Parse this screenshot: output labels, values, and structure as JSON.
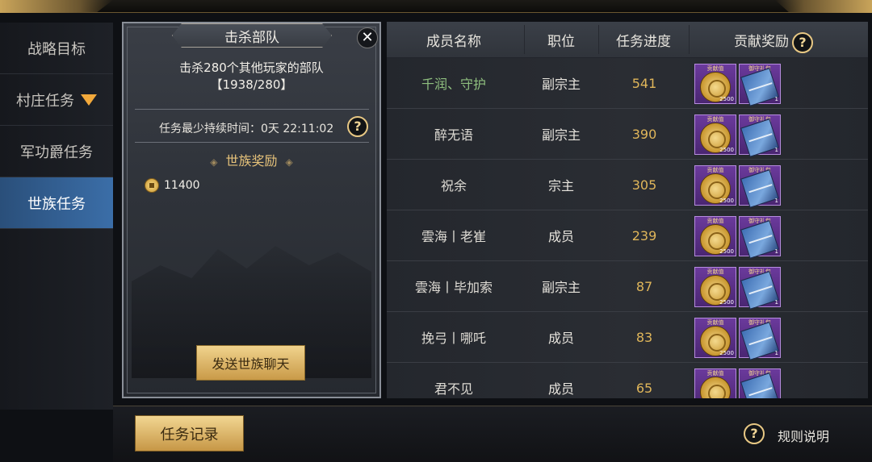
{
  "nav": {
    "items": [
      {
        "label": "战略目标"
      },
      {
        "label": "村庄任务"
      },
      {
        "label": "军功爵任务"
      },
      {
        "label": "世族任务"
      }
    ]
  },
  "task_panel": {
    "title": "击杀部队",
    "description": "击杀280个其他玩家的部队",
    "progress_text": "【1938/280】",
    "duration_text": "任务最少持续时间：0天 22:11:02",
    "reward_title": "世族奖励",
    "reward_amount": "11400",
    "send_chat_label": "发送世族聊天",
    "close_glyph": "✕",
    "help_glyph": "?"
  },
  "members": {
    "headers": {
      "name": "成员名称",
      "role": "职位",
      "progress": "任务进度",
      "reward": "贡献奖励"
    },
    "reward_labels": {
      "medal": "贡献值",
      "pack": "御守礼包"
    },
    "rows": [
      {
        "name": "千润、守护",
        "role": "副宗主",
        "progress": "541",
        "medal_count": "2500",
        "pack_count": "1"
      },
      {
        "name": "醉无语",
        "role": "副宗主",
        "progress": "390",
        "medal_count": "2500",
        "pack_count": "1"
      },
      {
        "name": "祝余",
        "role": "宗主",
        "progress": "305",
        "medal_count": "2500",
        "pack_count": "1"
      },
      {
        "name": "雲海丨老崔",
        "role": "成员",
        "progress": "239",
        "medal_count": "2500",
        "pack_count": "1"
      },
      {
        "name": "雲海丨毕加索",
        "role": "副宗主",
        "progress": "87",
        "medal_count": "2500",
        "pack_count": "1"
      },
      {
        "name": "挽弓丨哪吒",
        "role": "成员",
        "progress": "83",
        "medal_count": "2500",
        "pack_count": "1"
      },
      {
        "name": "君不见",
        "role": "成员",
        "progress": "65",
        "medal_count": "",
        "pack_count": ""
      }
    ]
  },
  "bottom": {
    "task_log_label": "任务记录",
    "rules_label": "规则说明"
  },
  "colors": {
    "accent_gold": "#e0b65a",
    "active_nav": "#3b6ea8",
    "highlight_name": "#8fbf7f"
  },
  "icons": {
    "close": "close-icon",
    "help": "help-icon",
    "coin": "coin-icon",
    "dropdown": "triangle-down-icon",
    "medal": "contribution-medal-icon",
    "pack": "gift-pack-icon"
  }
}
